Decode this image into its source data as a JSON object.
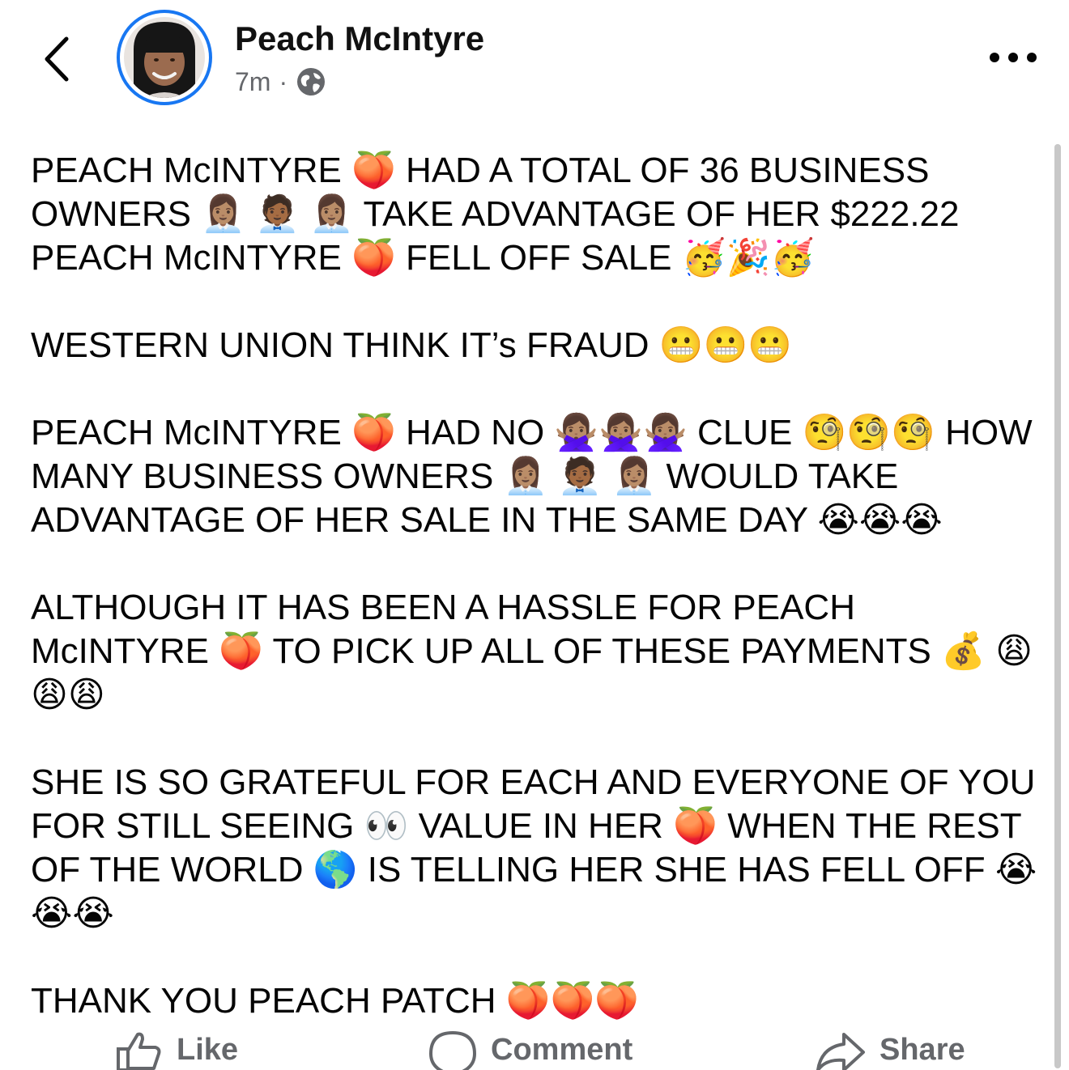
{
  "header": {
    "name": "Peach McIntyre",
    "time": "7m",
    "separator": "·",
    "privacy_icon": "globe-icon"
  },
  "post": {
    "paragraphs": [
      "PEACH McINTYRE 🍑 HAD A TOTAL OF 36 BUSINESS OWNERS 👩🏽‍💼 🧑🏾‍💼 👩🏽‍💼 TAKE ADVANTAGE OF HER $222.22 PEACH McINTYRE 🍑 FELL OFF SALE 🥳🎉🥳",
      "WESTERN UNION THINK IT’s FRAUD 😬😬😬",
      "PEACH McINTYRE 🍑 HAD NO 🙅🏽‍♀️🙅🏽‍♀️🙅🏽‍♀️ CLUE 🧐🧐🧐 HOW MANY BUSINESS OWNERS 👩🏽‍💼 🧑🏾‍💼 👩🏽‍💼 WOULD TAKE ADVANTAGE OF HER SALE IN THE SAME DAY 😭😭😭",
      "ALTHOUGH IT HAS BEEN A HASSLE FOR PEACH McINTYRE 🍑 TO PICK UP ALL OF THESE PAYMENTS 💰 😩😩😩",
      "SHE IS SO GRATEFUL FOR EACH AND EVERYONE OF YOU FOR STILL SEEING 👀 VALUE IN HER 🍑 WHEN THE REST OF THE WORLD 🌎 IS TELLING HER SHE HAS FELL OFF 😭😭😭",
      "THANK YOU PEACH PATCH 🍑🍑🍑"
    ]
  },
  "actions": {
    "like": "Like",
    "comment": "Comment",
    "share": "Share"
  },
  "colors": {
    "accent": "#1877f2",
    "secondary_text": "#65676b"
  }
}
